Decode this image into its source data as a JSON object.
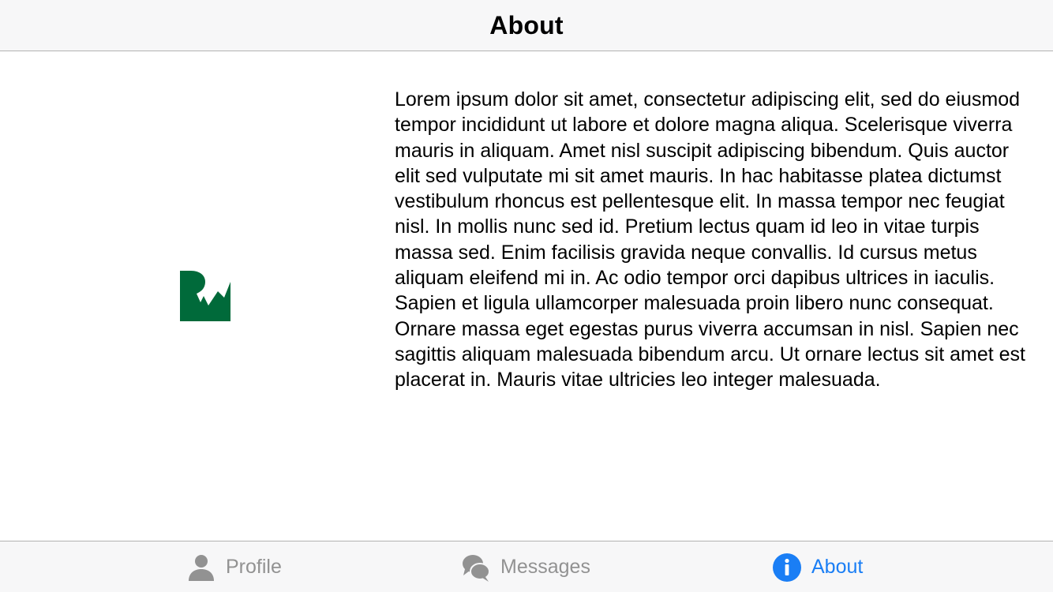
{
  "nav": {
    "title": "About"
  },
  "logo": {
    "icon": "rw-logo",
    "color": "#006a3a"
  },
  "content": {
    "body": "Lorem ipsum dolor sit amet, consectetur adipiscing elit, sed do eiusmod tempor incididunt ut labore et dolore magna aliqua. Scelerisque viverra mauris in aliquam. Amet nisl suscipit adipiscing bibendum. Quis auctor elit sed vulputate mi sit amet mauris. In hac habitasse platea dictumst vestibulum rhoncus est pellentesque elit. In massa tempor nec feugiat nisl. In mollis nunc sed id. Pretium lectus quam id leo in vitae turpis massa sed. Enim facilisis gravida neque convallis. Id cursus metus aliquam eleifend mi in. Ac odio tempor orci dapibus ultrices in iaculis. Sapien et ligula ullamcorper malesuada proin libero nunc consequat. Ornare massa eget egestas purus viverra accumsan in nisl. Sapien nec sagittis aliquam malesuada bibendum arcu. Ut ornare lectus sit amet est placerat in. Mauris vitae ultricies leo integer malesuada."
  },
  "tabbar": {
    "active_color": "#1a7ef5",
    "inactive_color": "#929292",
    "tabs": [
      {
        "label": "Profile",
        "icon": "person-icon",
        "selected": false
      },
      {
        "label": "Messages",
        "icon": "chat-bubbles-icon",
        "selected": false
      },
      {
        "label": "About",
        "icon": "info-icon",
        "selected": true
      }
    ]
  }
}
